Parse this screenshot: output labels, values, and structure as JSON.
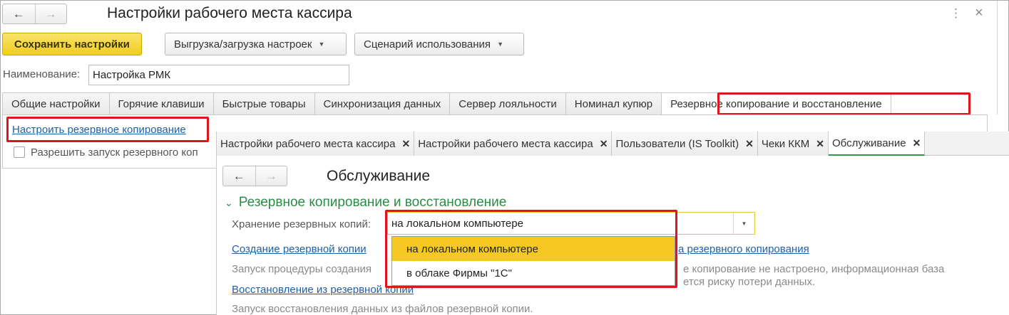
{
  "window": {
    "title": "Настройки рабочего места кассира",
    "back_icon": "arrow-left",
    "forward_icon": "arrow-right",
    "more_icon": "⋮",
    "close_icon": "×"
  },
  "toolbar": {
    "save_label": "Сохранить настройки",
    "export_label": "Выгрузка/загрузка настроек",
    "scenario_label": "Сценарий использования",
    "dropdown_glyph": "▼"
  },
  "name_field": {
    "label": "Наименование:",
    "value": "Настройка РМК"
  },
  "tabs": [
    {
      "label": "Общие настройки"
    },
    {
      "label": "Горячие клавиши"
    },
    {
      "label": "Быстрые товары"
    },
    {
      "label": "Синхронизация данных"
    },
    {
      "label": "Сервер лояльности"
    },
    {
      "label": "Номинал купюр"
    },
    {
      "label": "Резервное копирование и восстановление",
      "active": true
    }
  ],
  "backup_panel": {
    "configure_link": "Настроить резервное копирование",
    "allow_checkbox_label": "Разрешить запуск резервного коп"
  },
  "service_window": {
    "tabs": [
      {
        "label": "Настройки рабочего места кассира"
      },
      {
        "label": "Настройки рабочего места кассира"
      },
      {
        "label": "Пользователи (IS Toolkit)"
      },
      {
        "label": "Чеки ККМ"
      },
      {
        "label": "Обслуживание",
        "active": true
      }
    ],
    "tab_close_glyph": "✕",
    "title": "Обслуживание",
    "section_title": "Резервное копирование и восстановление",
    "section_chevron": "⌄",
    "storage_label": "Хранение резервных копий:",
    "storage_value": "на локальном компьютере",
    "storage_options": [
      "на локальном компьютере",
      "в облаке Фирмы \"1С\""
    ],
    "create_backup_link": "Создание резервной копии",
    "create_backup_desc": "Запуск процедуры создания",
    "backup_settings_link_tail": "а резервного копирования",
    "backup_warning_line1": "е копирование не настроено, информационная база",
    "backup_warning_line2": "ется риску потери данных.",
    "restore_link": "Восстановление из резервной копии",
    "restore_desc": "Запуск восстановления данных из файлов резервной копии."
  },
  "colors": {
    "primary_button": "#f0cd1f",
    "highlight_frame": "#e0151b",
    "section_green": "#2a8c45",
    "link_blue": "#1f5fa8",
    "selected_option": "#f6c824"
  }
}
